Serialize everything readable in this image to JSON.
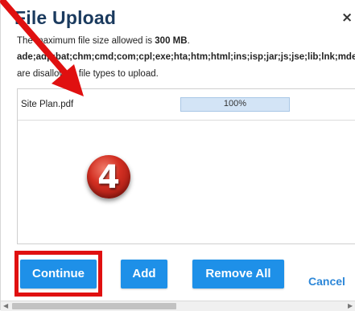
{
  "dialog": {
    "title": "File Upload",
    "close_glyph": "×"
  },
  "info": {
    "max_size_prefix": "The maximum file size allowed is ",
    "max_size_value": "300 MB",
    "max_size_suffix": ".",
    "extensions": "ade;adp;bat;chm;cmd;com;cpl;exe;hta;htm;html;ins;isp;jar;js;jse;lib;lnk;mde;m",
    "disallowed_note": "are disallowed file types to upload."
  },
  "files": [
    {
      "name": "Site Plan.pdf",
      "progress_text": "100%",
      "progress_fraction": 1.0
    }
  ],
  "step_badge": {
    "number": "4",
    "color": "#d32f22"
  },
  "buttons": {
    "continue": "Continue",
    "add": "Add",
    "remove_all": "Remove All",
    "cancel": "Cancel"
  },
  "annotation": {
    "arrow_color": "#e01010",
    "highlight_color": "#e01010"
  },
  "colors": {
    "title": "#1a3a5e",
    "button_bg": "#1e90e8",
    "cancel_link": "#2d87d8"
  },
  "icons": {
    "close": "close-icon",
    "scroll_left": "scroll-left-arrow-icon",
    "scroll_right": "scroll-right-arrow-icon"
  }
}
